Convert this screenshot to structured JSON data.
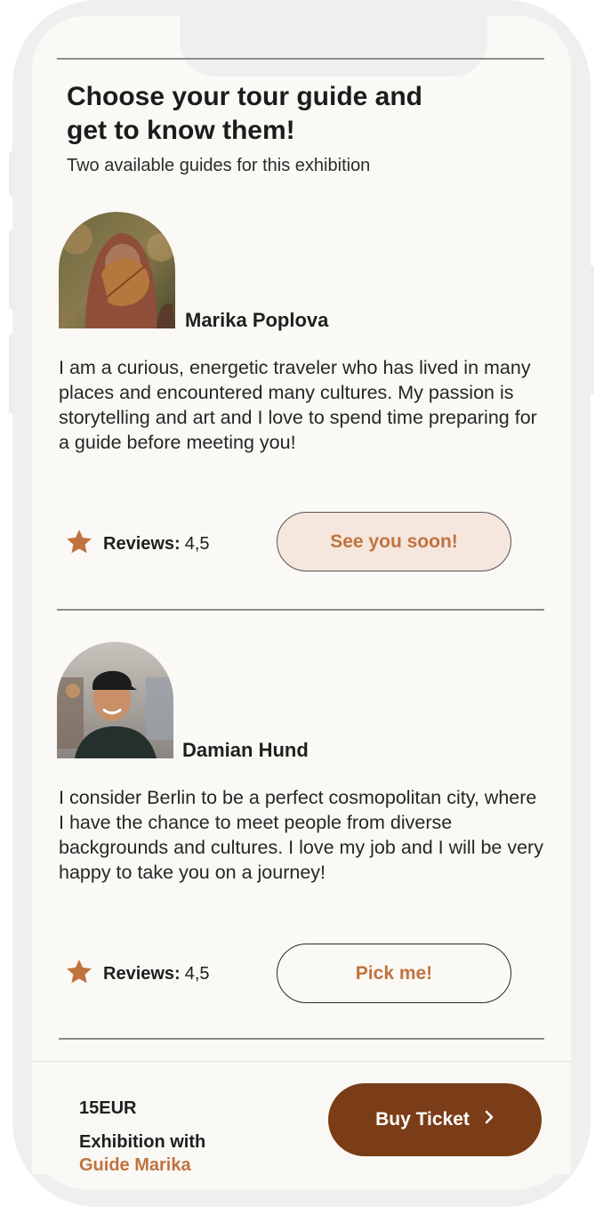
{
  "header": {
    "title": "Choose your tour guide and get to know them!",
    "subtitle": "Two available guides for this exhibition"
  },
  "guides": [
    {
      "name": "Marika Poplova",
      "bio": "I am a curious, energetic traveler who has lived in many places and encountered many cultures. My passion is storytelling and art and I love to spend time preparing for a guide before meeting you!",
      "reviews_label": "Reviews:",
      "reviews_value": "4,5",
      "button_label": "See you soon!",
      "selected": true,
      "icon": "star-icon"
    },
    {
      "name": "Damian Hund",
      "bio": "I consider Berlin to be a perfect cosmopolitan city, where I have the chance to meet people from diverse backgrounds and cultures. I love my job and I will be very happy to take you on a journey!",
      "reviews_label": "Reviews:",
      "reviews_value": "4,5",
      "button_label": "Pick me!",
      "selected": false,
      "icon": "star-icon"
    }
  ],
  "footer": {
    "price": "15EUR",
    "summary_line": "Exhibition with",
    "summary_guide": "Guide Marika",
    "buy_label": "Buy Ticket"
  },
  "colors": {
    "accent": "#c0733f",
    "buy_button": "#7b3d17",
    "selected_button_bg": "#f5e7dd",
    "screen_bg": "#fbf9f5"
  }
}
